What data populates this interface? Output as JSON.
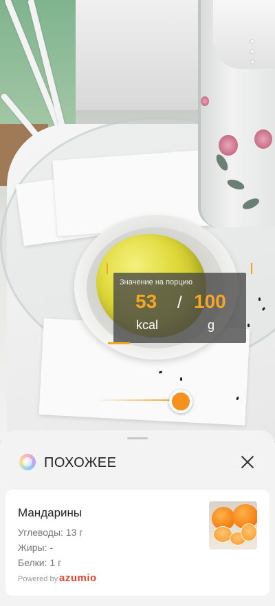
{
  "viewfinder": {
    "portion_title": "Значение на порцию",
    "calories_value": "53",
    "calories_unit": "kcal",
    "separator": "/",
    "weight_value": "100",
    "weight_unit": "g"
  },
  "sheet": {
    "title": "ПОХОЖЕЕ"
  },
  "result": {
    "name": "Мандарины",
    "carbs": "Углеводы: 13 г",
    "fat": "Жиры: -",
    "protein": "Белки: 1 г",
    "powered_by": "Powered by",
    "brand": "azumio"
  },
  "colors": {
    "accent": "#f5a623",
    "brand": "#e8412c"
  },
  "icons": [
    "more-vertical-icon",
    "bixby-icon",
    "close-icon"
  ]
}
